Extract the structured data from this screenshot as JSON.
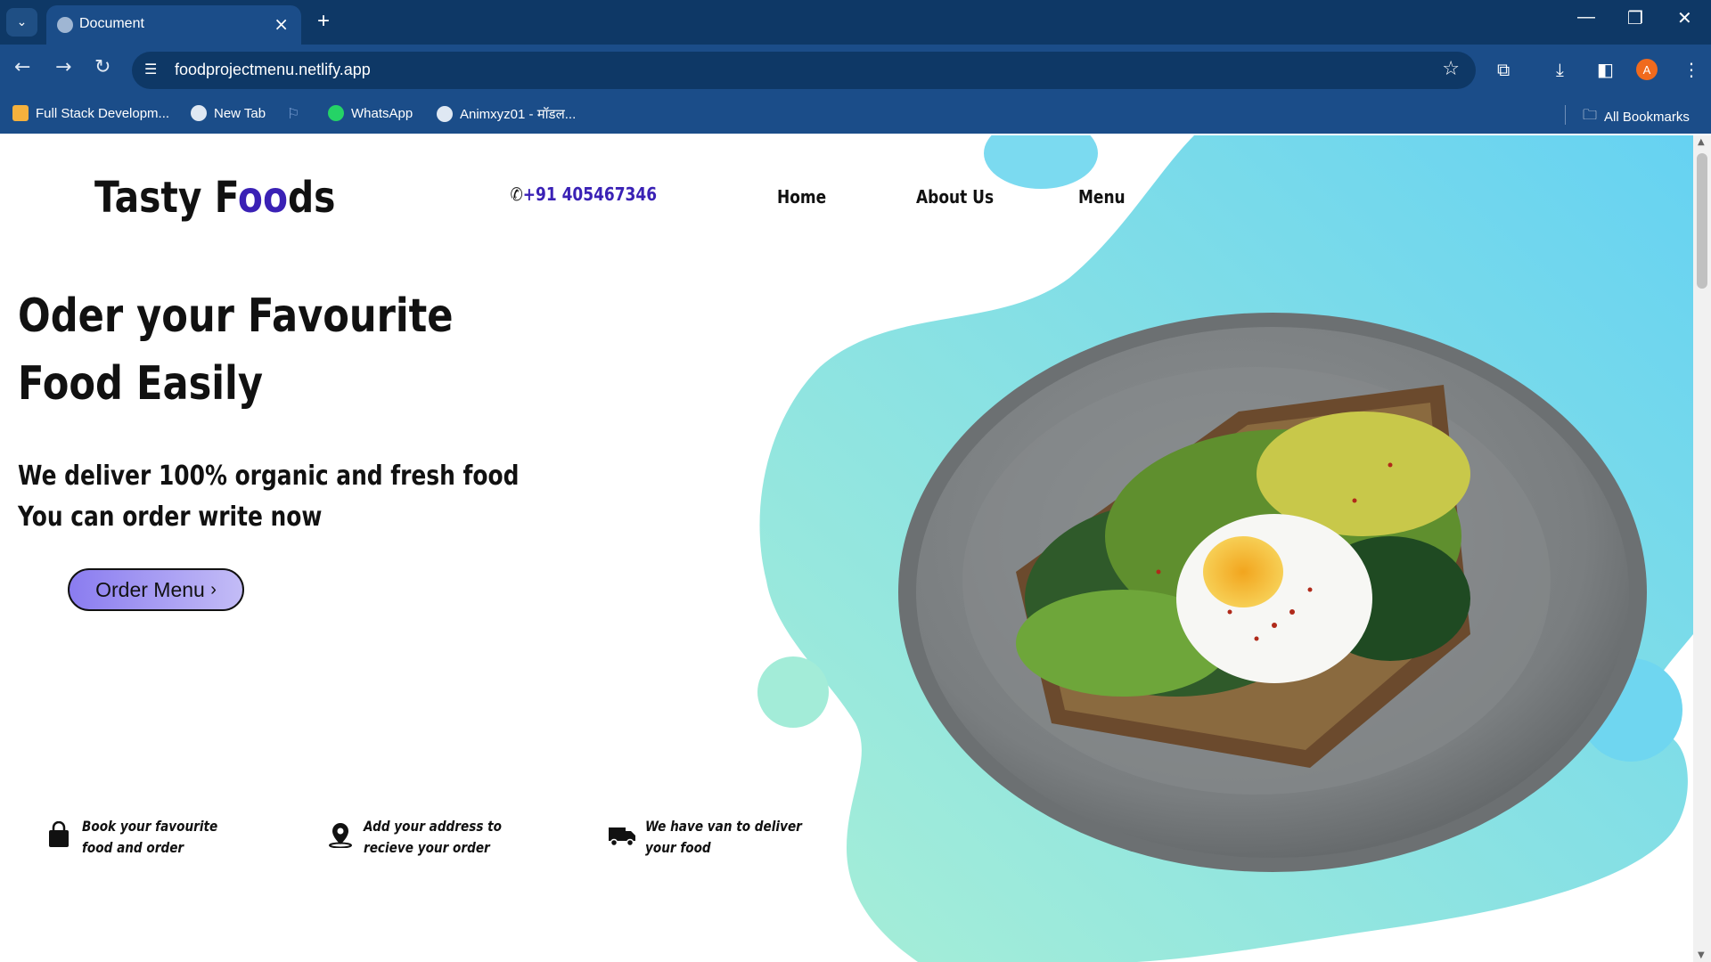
{
  "browser": {
    "tab_title": "Document",
    "url": "foodprojectmenu.netlify.app",
    "avatar_letter": "A",
    "bookmarks": [
      "Full Stack Developm...",
      "New Tab",
      "WhatsApp",
      "Animxyz01 - मॉडल..."
    ],
    "all_bookmarks": "All Bookmarks",
    "colors": {
      "frame": "#0e3866",
      "toolbar": "#1b4d89",
      "avatar": "#f06a1d"
    }
  },
  "site": {
    "brand_start": "Tasty F",
    "brand_accent": "oo",
    "brand_end": "ds",
    "phone": "+91 405467346",
    "nav": [
      "Home",
      "About Us",
      "Menu"
    ],
    "hero_line1": "Oder your Favourite",
    "hero_line2": "Food Easily",
    "sub_line1": "We deliver 100% organic and fresh food",
    "sub_line2": "You can order write now",
    "order_button": "Order Menu",
    "order_button_arrow": "›",
    "features": [
      {
        "icon": "shopping-bag-icon",
        "text": "Book your favourite food and order"
      },
      {
        "icon": "location-pin-icon",
        "text": "Add your address to recieve your order"
      },
      {
        "icon": "delivery-truck-icon",
        "text": "We have van to deliver your food"
      }
    ],
    "colors": {
      "accent": "#3a21b5",
      "blob_start": "#66d2f2",
      "blob_end": "#9ef0d8"
    }
  }
}
